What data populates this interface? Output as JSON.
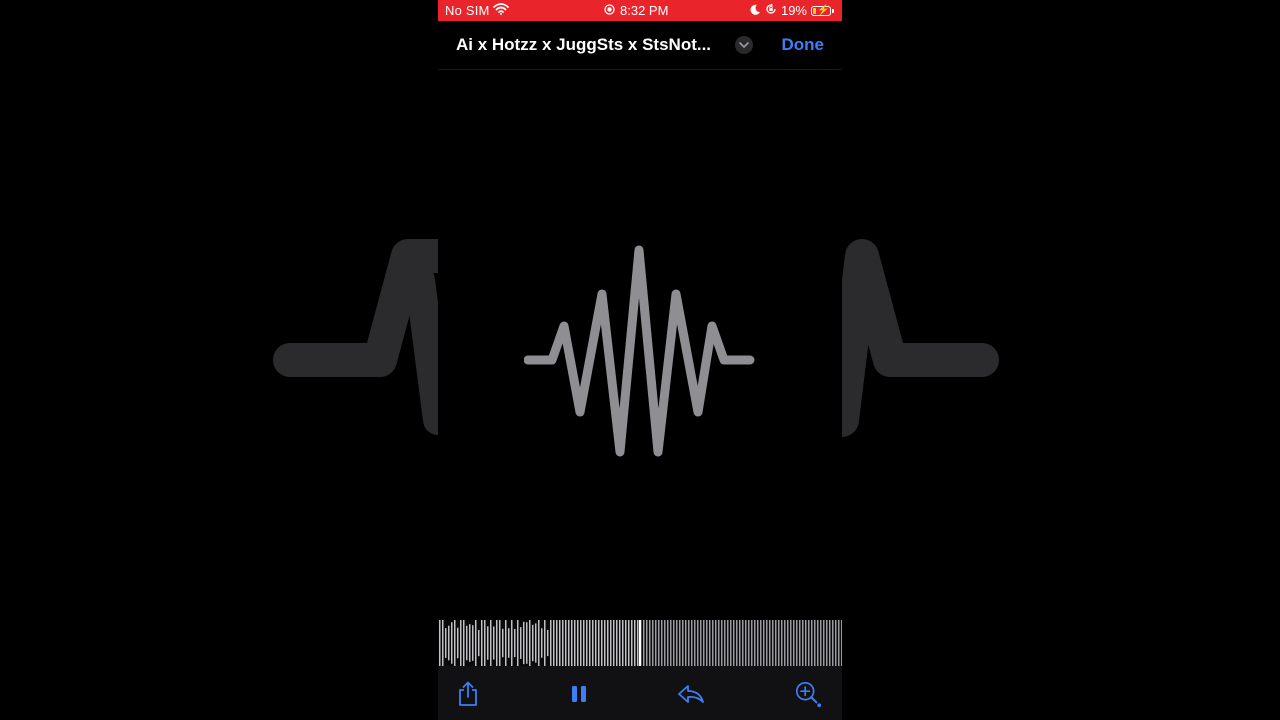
{
  "status_bar": {
    "carrier": "No SIM",
    "time": "8:32 PM",
    "battery": "19%",
    "battery_level": 0.19,
    "icons": [
      "wifi-icon",
      "recording-icon",
      "moon-icon",
      "orientation-lock-icon",
      "battery-icon",
      "charging-icon"
    ]
  },
  "nav": {
    "title": "Ai x Hotzz x JuggSts x StsNot...",
    "done_label": "Done"
  },
  "waveform": {
    "playhead_position": 0.5,
    "icon": "audio-waveform-icon"
  },
  "toolbar": {
    "buttons": [
      "share-icon",
      "pause-icon",
      "reply-icon",
      "zoom-in-icon"
    ]
  },
  "colors": {
    "status_bar": "#e9242b",
    "accent": "#3d7ef5",
    "glyph": "#8e8e93",
    "background": "#000000"
  }
}
